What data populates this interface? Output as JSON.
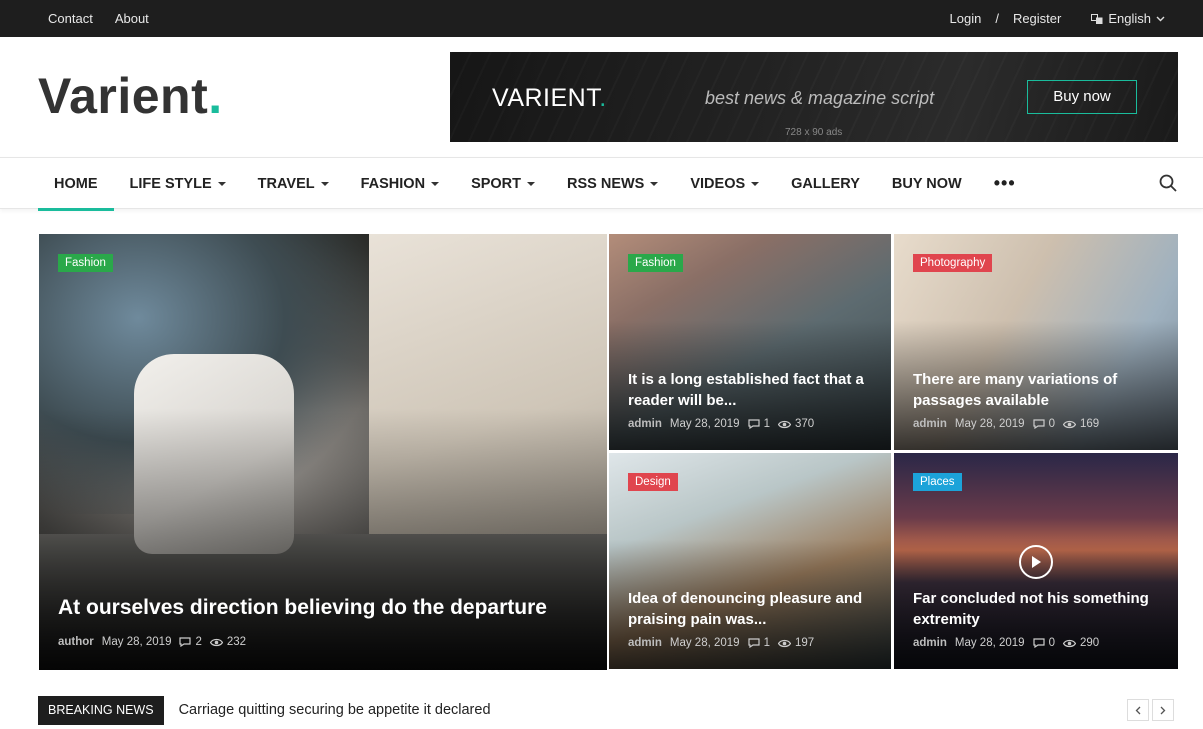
{
  "topbar": {
    "links": [
      "Contact",
      "About"
    ],
    "login": "Login",
    "separator": "/",
    "register": "Register",
    "language": "English"
  },
  "header": {
    "logo_text": "Varient",
    "logo_dot": ".",
    "ad": {
      "logo": "VARIENT",
      "logo_dot": ".",
      "tagline": "best news & magazine script",
      "size_label": "728 x 90 ads",
      "button": "Buy now"
    }
  },
  "nav": {
    "items": [
      {
        "label": "HOME",
        "active": true
      },
      {
        "label": "LIFE STYLE",
        "dropdown": true
      },
      {
        "label": "TRAVEL",
        "dropdown": true
      },
      {
        "label": "FASHION",
        "dropdown": true
      },
      {
        "label": "SPORT",
        "dropdown": true
      },
      {
        "label": "RSS NEWS",
        "dropdown": true
      },
      {
        "label": "VIDEOS",
        "dropdown": true
      },
      {
        "label": "GALLERY"
      },
      {
        "label": "BUY NOW"
      }
    ],
    "more": "•••"
  },
  "posts": [
    {
      "category": "Fashion",
      "badge_color": "#2aa84a",
      "title": "At ourselves direction believing do the departure",
      "author": "author",
      "date": "May 28, 2019",
      "comments": "2",
      "views": "232"
    },
    {
      "category": "Fashion",
      "badge_color": "#2aa84a",
      "title": "It is a long established fact that a reader will be...",
      "author": "admin",
      "date": "May 28, 2019",
      "comments": "1",
      "views": "370"
    },
    {
      "category": "Photography",
      "badge_color": "#e0454e",
      "title": "There are many variations of passages available",
      "author": "admin",
      "date": "May 28, 2019",
      "comments": "0",
      "views": "169"
    },
    {
      "category": "Design",
      "badge_color": "#e0454e",
      "title": "Idea of denouncing pleasure and praising pain was...",
      "author": "admin",
      "date": "May 28, 2019",
      "comments": "1",
      "views": "197"
    },
    {
      "category": "Places",
      "badge_color": "#1ca3d9",
      "title": "Far concluded not his something extremity",
      "author": "admin",
      "date": "May 28, 2019",
      "comments": "0",
      "views": "290"
    }
  ],
  "breaking": {
    "label": "BREAKING NEWS",
    "text": "Carriage quitting securing be appetite it declared"
  },
  "colors": {
    "accent": "#1abc9c",
    "topbar_bg": "#1e1e1e"
  }
}
